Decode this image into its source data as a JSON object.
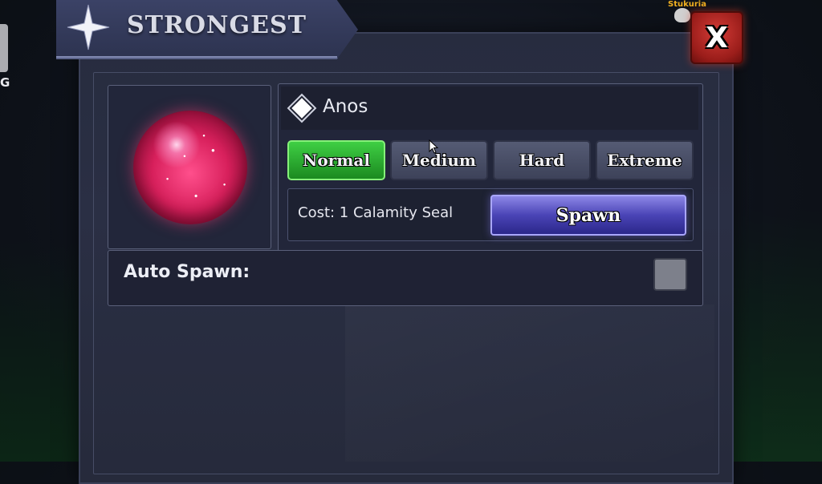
{
  "left_edge_text": "G",
  "panel": {
    "title": "STRONGEST",
    "close_label": "X",
    "player_tag": "Stukuria"
  },
  "boss": {
    "name": "Anos",
    "difficulties": [
      {
        "label": "Normal",
        "selected": true
      },
      {
        "label": "Medium",
        "selected": false
      },
      {
        "label": "Hard",
        "selected": false
      },
      {
        "label": "Extreme",
        "selected": false
      }
    ],
    "cost_text": "Cost: 1 Calamity Seal",
    "spawn_label": "Spawn"
  },
  "auto_spawn": {
    "label": "Auto Spawn:",
    "checked": false
  },
  "colors": {
    "selected_difficulty": "#2fae34",
    "spawn_button": "#4a44b6",
    "close_button": "#c0302b",
    "orb": "#e02a66"
  },
  "icons": [
    "star-emblem-icon",
    "diamond-icon",
    "skull-icon",
    "cursor-icon",
    "orb-item-icon"
  ]
}
